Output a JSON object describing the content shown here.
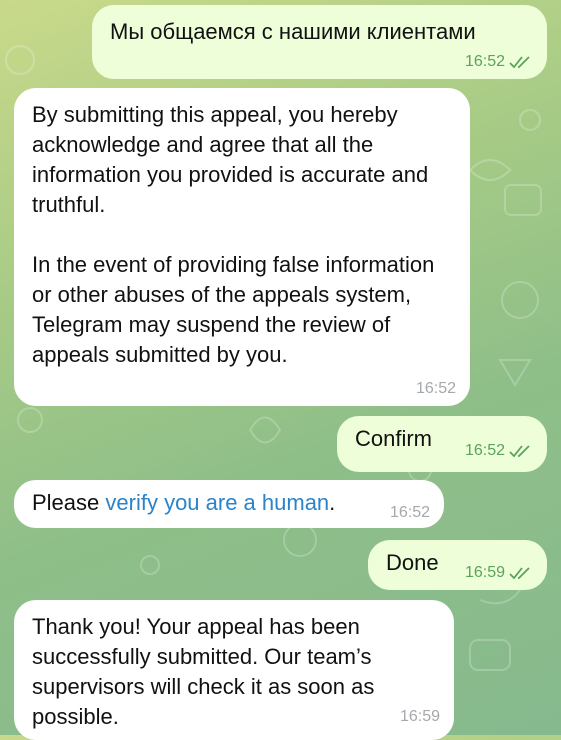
{
  "messages": [
    {
      "dir": "out",
      "text": "Мы общаемся с нашими клиентами",
      "time": "16:52",
      "read": true,
      "icon": "double-check-icon"
    },
    {
      "dir": "in",
      "paragraphs": [
        "By submitting this appeal, you hereby acknowledge and agree that all the information you provided is accurate and truthful.",
        "In the event of providing false information or other abuses of the appeals system, Telegram may suspend the review of appeals submitted by you."
      ],
      "time": "16:52"
    },
    {
      "dir": "out",
      "text": "Confirm",
      "time": "16:52",
      "read": true,
      "icon": "double-check-icon"
    },
    {
      "dir": "in",
      "text_before": "Please ",
      "link_text": "verify you are a human",
      "text_after": ".",
      "time": "16:52"
    },
    {
      "dir": "out",
      "text": "Done",
      "time": "16:59",
      "read": true,
      "icon": "double-check-icon"
    },
    {
      "dir": "in",
      "text": "Thank you! Your appeal has been successfully submitted. Our team’s supervisors will check it as soon as possible.",
      "time": "16:59"
    }
  ],
  "colors": {
    "outgoing_bubble": "#eefed9",
    "incoming_bubble": "#ffffff",
    "outgoing_meta": "#5aa35a",
    "incoming_meta": "#a4a9ad",
    "link": "#2b83c9"
  }
}
